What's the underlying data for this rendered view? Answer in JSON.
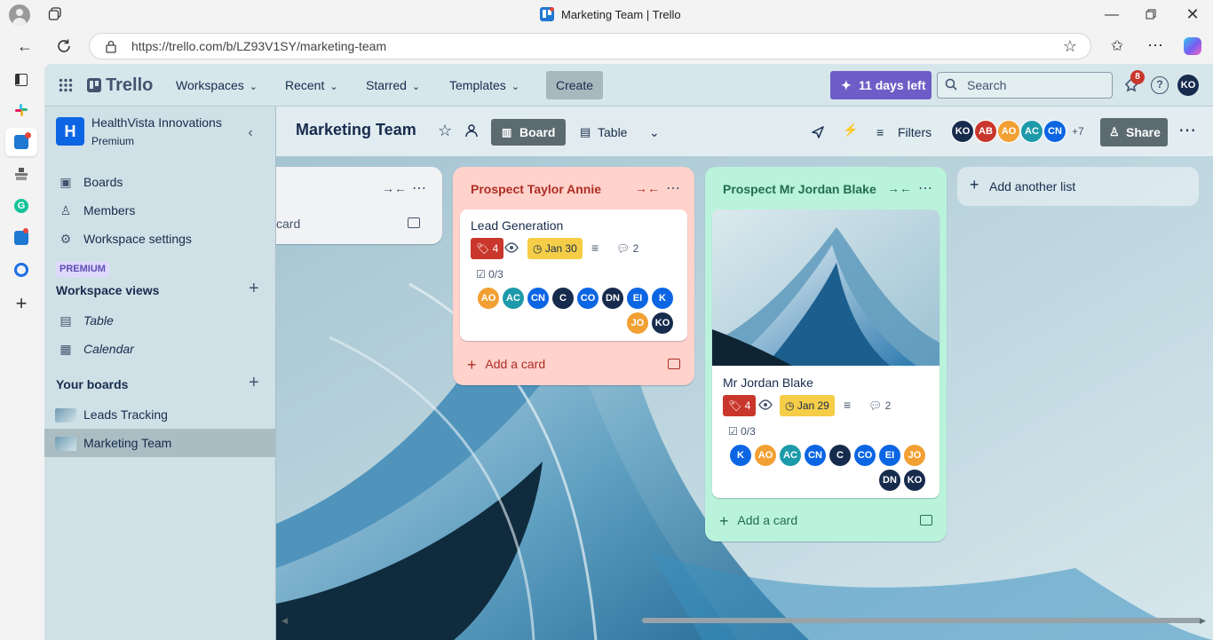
{
  "browser": {
    "tab_title": "Marketing Team | Trello",
    "url": "https://trello.com/b/LZ93V1SY/marketing-team"
  },
  "nav": {
    "logo": "Trello",
    "workspaces": "Workspaces",
    "recent": "Recent",
    "starred": "Starred",
    "templates": "Templates",
    "create": "Create",
    "trial": "11 days left",
    "search_placeholder": "Search",
    "notification_count": "8",
    "user_initials": "KO"
  },
  "sidebar": {
    "workspace_initial": "H",
    "workspace_name": "HealthVista Innovations",
    "workspace_plan": "Premium",
    "items": [
      {
        "label": "Boards"
      },
      {
        "label": "Members"
      },
      {
        "label": "Workspace settings"
      }
    ],
    "premium_badge": "PREMIUM",
    "views_title": "Workspace views",
    "views": [
      {
        "label": "Table"
      },
      {
        "label": "Calendar"
      }
    ],
    "boards_title": "Your boards",
    "boards": [
      {
        "label": "Leads Tracking"
      },
      {
        "label": "Marketing Team"
      }
    ]
  },
  "board": {
    "title": "Marketing Team",
    "view_board": "Board",
    "view_table": "Table",
    "filters": "Filters",
    "members_extra": "+7",
    "share": "Share",
    "header_members": [
      {
        "initials": "KO",
        "color": "#172b4d"
      },
      {
        "initials": "AB",
        "color": "#c9372c"
      },
      {
        "initials": "AO",
        "color": "#f2a033"
      },
      {
        "initials": "AC",
        "color": "#1d9aaa"
      },
      {
        "initials": "CN",
        "color": "#0c66e4"
      }
    ]
  },
  "lists": {
    "partial": {
      "add_card": "card"
    },
    "taylor": {
      "title": "Prospect Taylor Annie",
      "bg_color": "#ffd2cc",
      "card": {
        "title": "Lead Generation",
        "label_count": "4",
        "date": "Jan 30",
        "comments": "2",
        "checklist": "0/3",
        "members": [
          {
            "initials": "AO",
            "color": "#f2a033"
          },
          {
            "initials": "AC",
            "color": "#1d9aaa"
          },
          {
            "initials": "CN",
            "color": "#0c66e4"
          },
          {
            "initials": "C",
            "color": "#172b4d"
          },
          {
            "initials": "CO",
            "color": "#0c66e4"
          },
          {
            "initials": "DN",
            "color": "#172b4d"
          },
          {
            "initials": "EI",
            "color": "#0c66e4"
          },
          {
            "initials": "K",
            "color": "#0c66e4"
          },
          {
            "initials": "JO",
            "color": "#f2a033"
          },
          {
            "initials": "KO",
            "color": "#172b4d"
          }
        ]
      },
      "add_card": "Add a card"
    },
    "jordan": {
      "title": "Prospect Mr Jordan Blake",
      "bg_color": "#baf3db",
      "card": {
        "title": "Mr Jordan Blake",
        "label_count": "4",
        "date": "Jan 29",
        "comments": "2",
        "checklist": "0/3",
        "members": [
          {
            "initials": "K",
            "color": "#0c66e4"
          },
          {
            "initials": "AO",
            "color": "#f2a033"
          },
          {
            "initials": "AC",
            "color": "#1d9aaa"
          },
          {
            "initials": "CN",
            "color": "#0c66e4"
          },
          {
            "initials": "C",
            "color": "#172b4d"
          },
          {
            "initials": "CO",
            "color": "#0c66e4"
          },
          {
            "initials": "EI",
            "color": "#0c66e4"
          },
          {
            "initials": "JO",
            "color": "#f2a033"
          },
          {
            "initials": "DN",
            "color": "#172b4d"
          },
          {
            "initials": "KO",
            "color": "#172b4d"
          }
        ]
      },
      "add_card": "Add a card"
    },
    "add_another": "Add another list"
  }
}
